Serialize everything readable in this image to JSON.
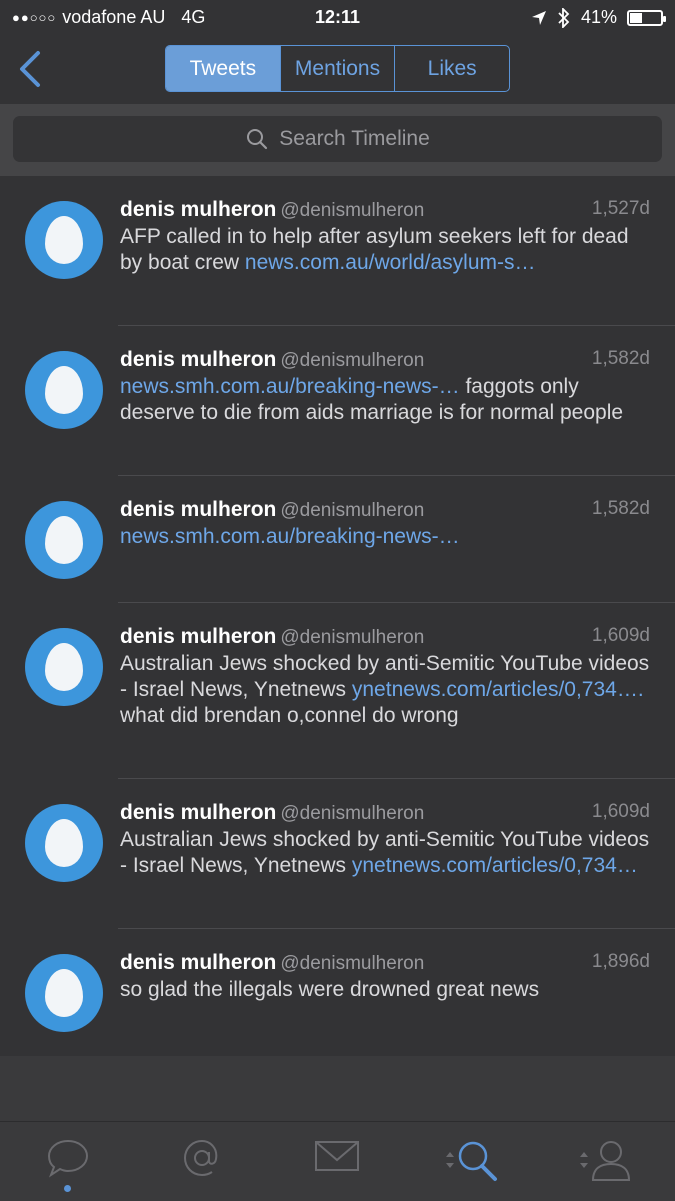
{
  "status_bar": {
    "signal_dots": "●●○○○",
    "carrier": "vodafone AU",
    "network": "4G",
    "time": "12:11",
    "battery_percent_text": "41%",
    "battery_level": 0.41
  },
  "nav": {
    "back_icon": "chevron-left-icon",
    "tabs": [
      {
        "label": "Tweets",
        "active": true
      },
      {
        "label": "Mentions",
        "active": false
      },
      {
        "label": "Likes",
        "active": false
      }
    ]
  },
  "search": {
    "placeholder": "Search Timeline",
    "icon": "search-icon"
  },
  "tweets": [
    {
      "name": "denis mulheron",
      "handle": "@denismulheron",
      "age": "1,527d",
      "text_before": "AFP called in to help after asylum seekers left for dead by boat crew  ",
      "link": "news.com.au/world/asylum-s…",
      "text_after": ""
    },
    {
      "name": "denis mulheron",
      "handle": "@denismulheron",
      "age": "1,582d",
      "text_before": "",
      "link": "news.smh.com.au/breaking-news-…",
      "text_after": " faggots only deserve to die from aids marriage is for normal people"
    },
    {
      "name": "denis mulheron",
      "handle": "@denismulheron",
      "age": "1,582d",
      "text_before": "",
      "link": "news.smh.com.au/breaking-news-…",
      "text_after": ""
    },
    {
      "name": "denis mulheron",
      "handle": "@denismulheron",
      "age": "1,609d",
      "text_before": "Australian Jews shocked by anti-Semitic YouTube videos - Israel News, Ynetnews ",
      "link": "ynetnews.com/articles/0,734…. ",
      "text_after": " what did brendan o,connel do wrong"
    },
    {
      "name": "denis mulheron",
      "handle": "@denismulheron",
      "age": "1,609d",
      "text_before": "Australian Jews shocked by anti-Semitic YouTube videos - Israel News, Ynetnews ",
      "link": "ynetnews.com/articles/0,734…",
      "text_after": ""
    },
    {
      "name": "denis mulheron",
      "handle": "@denismulheron",
      "age": "1,896d",
      "text_before": "so glad the illegals were drowned great news",
      "link": "",
      "text_after": ""
    }
  ],
  "tab_bar": {
    "items": [
      {
        "icon": "speech-bubble-icon",
        "active": true
      },
      {
        "icon": "at-sign-icon",
        "active": false
      },
      {
        "icon": "envelope-icon",
        "active": false
      },
      {
        "icon": "search-icon",
        "active": false
      },
      {
        "icon": "person-icon",
        "active": false
      }
    ]
  },
  "colors": {
    "accent": "#5a93d6",
    "avatar": "#3d96dc",
    "background": "#333335"
  }
}
